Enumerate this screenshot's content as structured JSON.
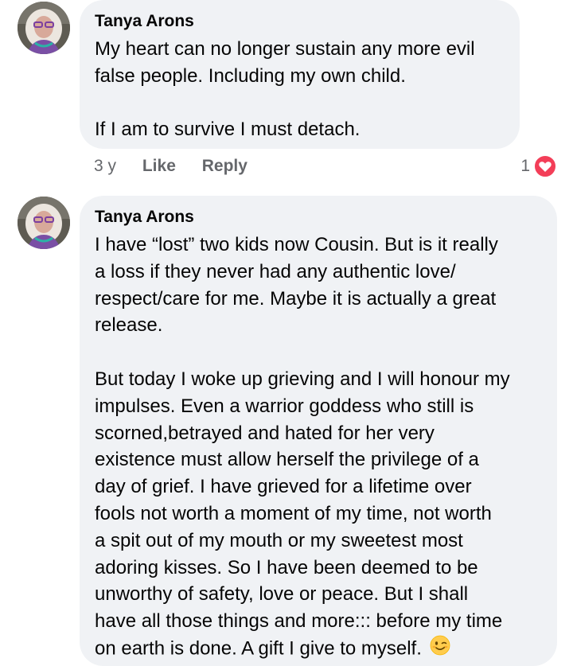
{
  "comments": [
    {
      "author": "Tanya Arons",
      "lines": [
        "My heart can no longer sustain any more evil",
        "false people.  Including my own child.",
        "",
        "If I am to survive I must detach."
      ],
      "time": "3 y",
      "like_label": "Like",
      "reply_label": "Reply",
      "reaction_count": "1",
      "reaction_icon": "love-heart-icon",
      "reaction_color": "#f33e58"
    },
    {
      "author": "Tanya Arons",
      "lines": [
        "I have “lost” two kids now Cousin.  But is it really",
        "a loss if they never had any authentic love/",
        "respect/care for me.  Maybe it is actually a great",
        "release.",
        "",
        "But today I woke up grieving and I will honour my",
        "impulses. Even a warrior goddess who still is",
        "scorned,betrayed and hated for her very",
        "existence must allow herself the privilege of a",
        "day of grief.  I have grieved for a lifetime over",
        "fools not worth a moment of my time, not worth",
        "a spit out of my mouth or my sweetest most",
        "adoring kisses.  So I have been deemed to be",
        "unworthy of safety, love or peace.  But I shall",
        "have all those things and more::: before my time",
        "on earth is done. A gift I give to myself."
      ],
      "trailing_emoji": "winking-face-emoji"
    }
  ],
  "colors": {
    "bubble": "#f0f2f5",
    "secondary_text": "#65676b",
    "primary_text": "#050505"
  }
}
